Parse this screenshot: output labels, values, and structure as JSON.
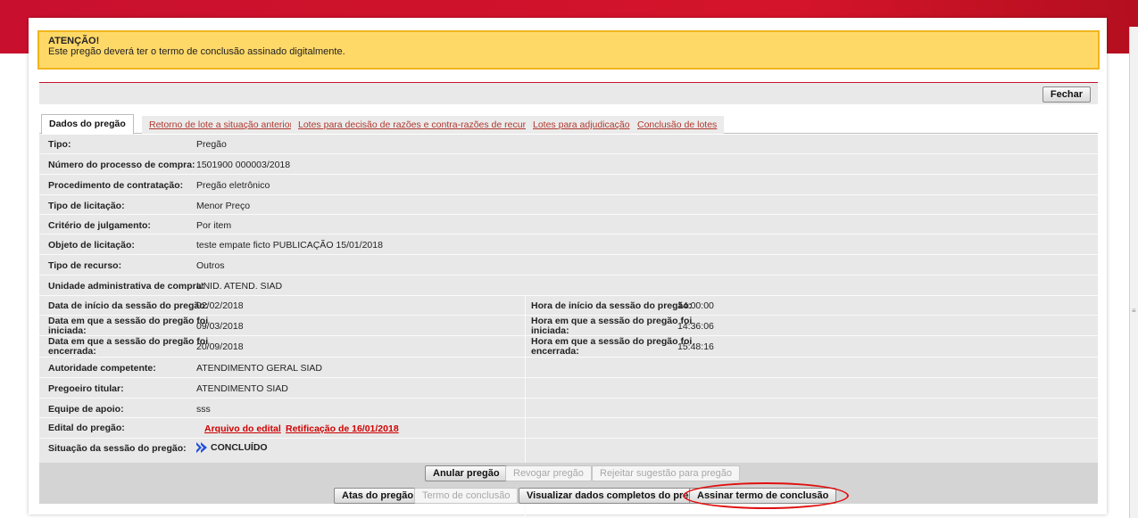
{
  "alert": {
    "title": "ATENÇÃO!",
    "message": "Este pregão deverá ter o termo de conclusão assinado digitalmente."
  },
  "toolbar": {
    "close_label": "Fechar"
  },
  "tabs": [
    {
      "label": "Dados do pregão",
      "active": true
    },
    {
      "label": "Retorno de lote a situação anterior",
      "active": false
    },
    {
      "label": "Lotes para decisão de razões e contra-razões de recurso",
      "active": false
    },
    {
      "label": "Lotes para adjudicação",
      "active": false
    },
    {
      "label": "Conclusão de lotes",
      "active": false
    }
  ],
  "fields": {
    "tipo": {
      "label": "Tipo:",
      "value": "Pregão"
    },
    "numero": {
      "label": "Número do processo de compra:",
      "value": "1501900 000003/2018"
    },
    "procedimento": {
      "label": "Procedimento de contratação:",
      "value": "Pregão eletrônico"
    },
    "tipo_licitacao": {
      "label": "Tipo de licitação:",
      "value": "Menor Preço"
    },
    "criterio": {
      "label": "Critério de julgamento:",
      "value": "Por item"
    },
    "objeto": {
      "label": "Objeto de licitação:",
      "value": "teste empate ficto PUBLICAÇÃO 15/01/2018"
    },
    "tipo_recurso": {
      "label": "Tipo de recurso:",
      "value": "Outros"
    },
    "unidade": {
      "label": "Unidade administrativa de compra:",
      "value": "UNID. ATEND. SIAD"
    },
    "data_inicio": {
      "label": "Data de início da sessão do pregão:",
      "value": "02/02/2018"
    },
    "hora_inicio": {
      "label": "Hora de início da sessão do pregão:",
      "value": "14:00:00"
    },
    "data_iniciada": {
      "label1": "Data em que a sessão do pregão foi",
      "label2": "iniciada:",
      "value": "09/03/2018"
    },
    "hora_iniciada": {
      "label1": "Hora em que a sessão do pregão foi",
      "label2": "iniciada:",
      "value": "14:36:06"
    },
    "data_encerrada": {
      "label1": "Data em que a sessão do pregão foi",
      "label2": "encerrada:",
      "value": "20/09/2018"
    },
    "hora_encerrada": {
      "label1": "Hora em que a sessão do pregão foi",
      "label2": "encerrada:",
      "value": "15:48:16"
    },
    "autoridade": {
      "label": "Autoridade competente:",
      "value": "ATENDIMENTO GERAL SIAD"
    },
    "pregoeiro": {
      "label": "Pregoeiro titular:",
      "value": "ATENDIMENTO SIAD"
    },
    "equipe": {
      "label": "Equipe de apoio:",
      "value": "sss"
    },
    "edital": {
      "label": "Edital do pregão:",
      "link1": "Arquivo do edital",
      "link2": "Retificação de 16/01/2018"
    },
    "situacao": {
      "label": "Situação da sessão do pregão:",
      "value": "CONCLUÍDO"
    }
  },
  "actions": {
    "anular": "Anular pregão",
    "revogar": "Revogar pregão",
    "rejeitar": "Rejeitar sugestão para pregão",
    "atas": "Atas do pregão",
    "termo": "Termo de conclusão",
    "visualizar": "Visualizar dados completos do pregão",
    "assinar": "Assinar termo de conclusão"
  },
  "colors": {
    "brand_red": "#c8102e",
    "alert_bg": "#ffd968",
    "status_blue": "#1f4fd6",
    "highlight_ellipse": "#e01010"
  }
}
